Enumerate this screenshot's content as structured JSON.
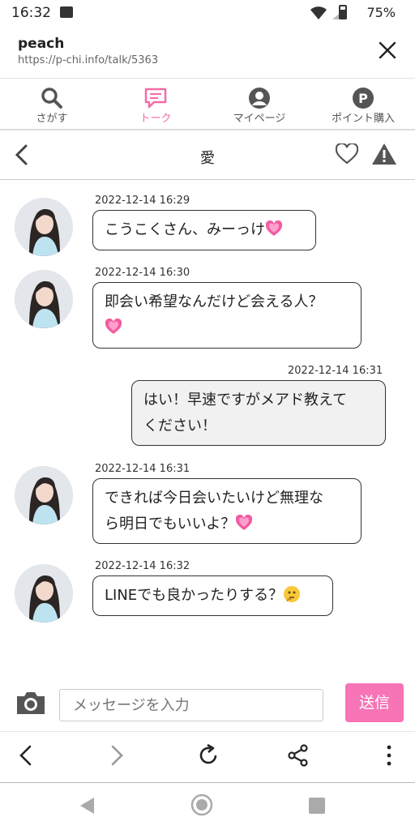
{
  "status": {
    "time": "16:32",
    "battery": "75%"
  },
  "browser": {
    "title": "peach",
    "url": "https://p-chi.info/talk/5363",
    "close_icon": "close-icon"
  },
  "tabs": [
    {
      "label": "さがす",
      "icon": "search-icon",
      "active": false
    },
    {
      "label": "トーク",
      "icon": "chat-icon",
      "active": true
    },
    {
      "label": "マイページ",
      "icon": "user-icon",
      "active": false
    },
    {
      "label": "ポイント購入",
      "icon": "points-icon",
      "active": false
    }
  ],
  "colors": {
    "accent": "#f56aa8",
    "send": "#f774b6"
  },
  "chat": {
    "partner_name": "愛"
  },
  "messages": [
    {
      "from": "partner",
      "time": "2022-12-14 16:29",
      "text": "こうこくさん、みーっけ",
      "emoji": "heart"
    },
    {
      "from": "partner",
      "time": "2022-12-14 16:30",
      "text": "即会い希望なんだけど会える人？",
      "emoji": "heart"
    },
    {
      "from": "me",
      "time": "2022-12-14 16:31",
      "line1": "はい！早速ですがメアド教えて",
      "line2": "ください！"
    },
    {
      "from": "partner",
      "time": "2022-12-14 16:31",
      "line1": "できれば今日会いたいけど無理な",
      "line2": "ら明日でもいいよ？",
      "emoji": "heart"
    },
    {
      "from": "partner",
      "time": "2022-12-14 16:32",
      "text": "LINEでも良かったりする？",
      "emoji": "thinking"
    }
  ],
  "input": {
    "placeholder": "メッセージを入力",
    "send_label": "送信"
  }
}
